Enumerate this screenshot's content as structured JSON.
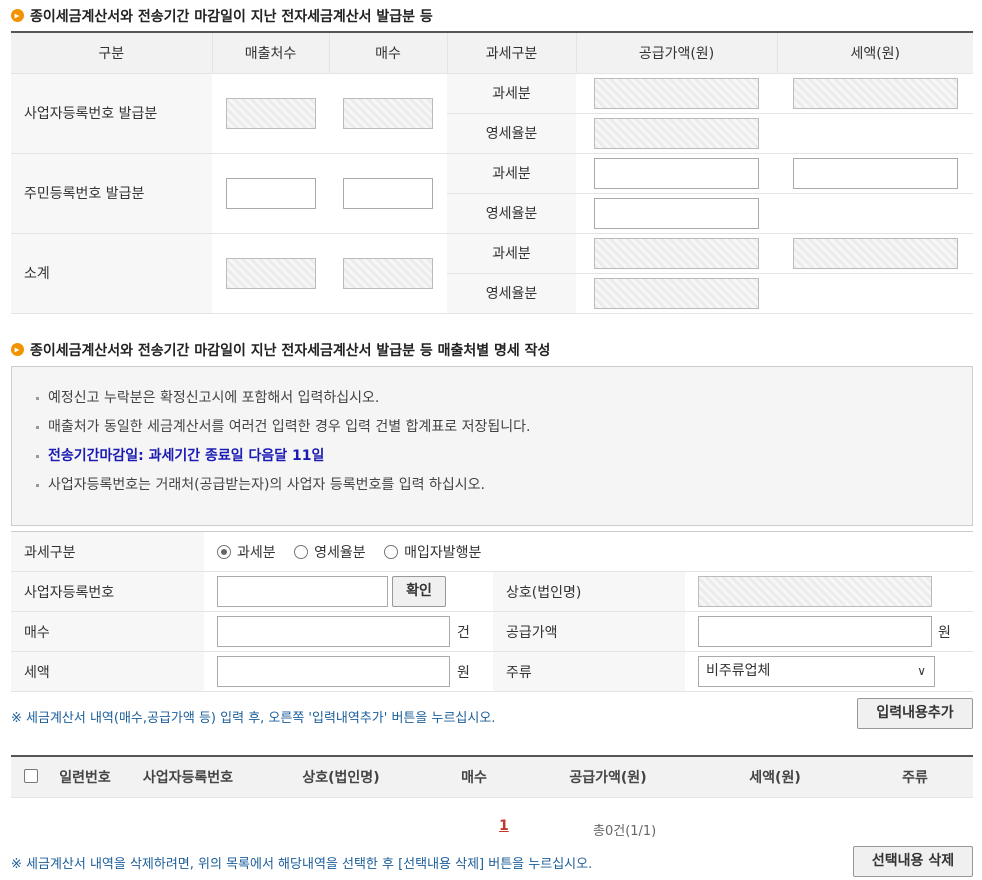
{
  "section1": {
    "title": "종이세금계산서와 전송기간 마감일이 지난 전자세금계산서 발급분 등",
    "headers": [
      "구분",
      "매출처수",
      "매수",
      "과세구분",
      "공급가액(원)",
      "세액(원)"
    ],
    "rows": [
      {
        "label": "사업자등록번호 발급분",
        "sub1": "과세분",
        "sub2": "영세율분"
      },
      {
        "label": "주민등록번호 발급분",
        "sub1": "과세분",
        "sub2": "영세율분"
      },
      {
        "label": "소계",
        "sub1": "과세분",
        "sub2": "영세율분"
      }
    ]
  },
  "section2": {
    "title": "종이세금계산서와 전송기간 마감일이 지난 전자세금계산서 발급분 등 매출처별 명세 작성",
    "notes": [
      "예정신고 누락분은 확정신고시에 포함해서 입력하십시오.",
      "매출처가 동일한 세금계산서를 여러건 입력한 경우 입력 건별 합계표로 저장됩니다.",
      "전송기간마감일: 과세기간 종료일 다음달 11일",
      "사업자등록번호는 거래처(공급받는자)의 사업자 등록번호를 입력 하십시오."
    ]
  },
  "form": {
    "tax_type_label": "과세구분",
    "tax_options": [
      "과세분",
      "영세율분",
      "매입자발행분"
    ],
    "tax_selected": "과세분",
    "bizno_label": "사업자등록번호",
    "confirm_button": "확인",
    "company_label": "상호(법인명)",
    "count_label": "매수",
    "count_unit": "건",
    "supply_label": "공급가액",
    "supply_unit": "원",
    "tax_label": "세액",
    "tax_unit": "원",
    "kind_label": "주류",
    "kind_value": "비주류업체"
  },
  "add_note": "※ 세금계산서 내역(매수,공급가액 등) 입력 후, 오른쪽 '입력내역추가' 버튼을 누르십시오.",
  "add_button": "입력내용추가",
  "list": {
    "headers": [
      "일련번호",
      "사업자등록번호",
      "상호(법인명)",
      "매수",
      "공급가액(원)",
      "세액(원)",
      "주류"
    ]
  },
  "pagination": {
    "current": "1",
    "total": "총0건(1/1)"
  },
  "delete_note": "※ 세금계산서 내역을 삭제하려면, 위의 목록에서 해당내역을 선택한 후 [선택내용 삭제] 버튼을 누르십시오.",
  "delete_button": "선택내용 삭제"
}
